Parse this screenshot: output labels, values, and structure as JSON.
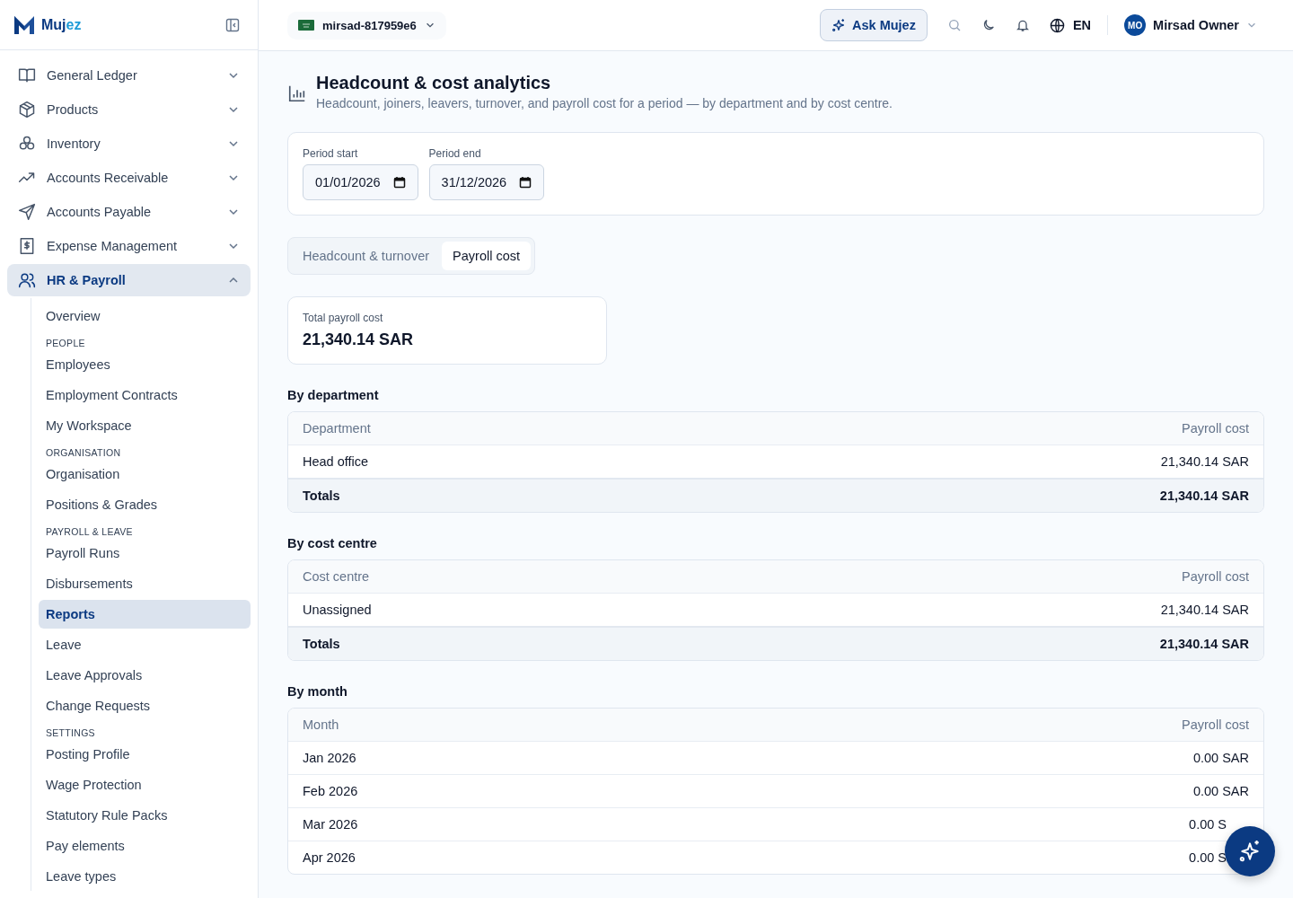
{
  "logo_text": [
    "Muj",
    "ez"
  ],
  "workspace": {
    "label": "mirsad-817959e6"
  },
  "header": {
    "ask_button": "Ask Mujez",
    "language": "EN",
    "user": {
      "initials": "MO",
      "name": "Mirsad Owner"
    }
  },
  "sidebar": {
    "items": [
      {
        "label": "General Ledger",
        "expanded": false,
        "selected": false
      },
      {
        "label": "Products",
        "expanded": false,
        "selected": false
      },
      {
        "label": "Inventory",
        "expanded": false,
        "selected": false
      },
      {
        "label": "Accounts Receivable",
        "expanded": false,
        "selected": false
      },
      {
        "label": "Accounts Payable",
        "expanded": false,
        "selected": false
      },
      {
        "label": "Expense Management",
        "expanded": false,
        "selected": false
      },
      {
        "label": "HR & Payroll",
        "expanded": true,
        "selected": true,
        "children": [
          {
            "kind": "link",
            "label": "Overview",
            "selected": false
          },
          {
            "kind": "heading",
            "label": "PEOPLE"
          },
          {
            "kind": "link",
            "label": "Employees",
            "selected": false
          },
          {
            "kind": "link",
            "label": "Employment Contracts",
            "selected": false
          },
          {
            "kind": "link",
            "label": "My Workspace",
            "selected": false
          },
          {
            "kind": "heading",
            "label": "ORGANISATION"
          },
          {
            "kind": "link",
            "label": "Organisation",
            "selected": false
          },
          {
            "kind": "link",
            "label": "Positions & Grades",
            "selected": false
          },
          {
            "kind": "heading",
            "label": "PAYROLL & LEAVE"
          },
          {
            "kind": "link",
            "label": "Payroll Runs",
            "selected": false
          },
          {
            "kind": "link",
            "label": "Disbursements",
            "selected": false
          },
          {
            "kind": "link",
            "label": "Reports",
            "selected": true
          },
          {
            "kind": "link",
            "label": "Leave",
            "selected": false
          },
          {
            "kind": "link",
            "label": "Leave Approvals",
            "selected": false
          },
          {
            "kind": "link",
            "label": "Change Requests",
            "selected": false
          },
          {
            "kind": "heading",
            "label": "SETTINGS"
          },
          {
            "kind": "link",
            "label": "Posting Profile",
            "selected": false
          },
          {
            "kind": "link",
            "label": "Wage Protection",
            "selected": false
          },
          {
            "kind": "link",
            "label": "Statutory Rule Packs",
            "selected": false
          },
          {
            "kind": "link",
            "label": "Pay elements",
            "selected": false
          },
          {
            "kind": "link",
            "label": "Leave types",
            "selected": false
          }
        ]
      }
    ]
  },
  "page": {
    "title": "Headcount & cost analytics",
    "subtitle": "Headcount, joiners, leavers, turnover, and payroll cost for a period — by department and by cost centre."
  },
  "filters": [
    {
      "label": "Period start",
      "value": "01/01/2026"
    },
    {
      "label": "Period end",
      "value": "31/12/2026"
    }
  ],
  "tabs": [
    {
      "label": "Headcount & turnover",
      "selected": false
    },
    {
      "label": "Payroll cost",
      "selected": true
    }
  ],
  "summary": {
    "label": "Total payroll cost",
    "value": "21,340.14 SAR"
  },
  "sections": [
    {
      "title": "By department",
      "columns": [
        "Department",
        "Payroll cost"
      ],
      "rows": [
        [
          "Head office",
          "21,340.14 SAR"
        ]
      ],
      "totals": [
        "Totals",
        "21,340.14 SAR"
      ]
    },
    {
      "title": "By cost centre",
      "columns": [
        "Cost centre",
        "Payroll cost"
      ],
      "rows": [
        [
          "Unassigned",
          "21,340.14 SAR"
        ]
      ],
      "totals": [
        "Totals",
        "21,340.14 SAR"
      ]
    },
    {
      "title": "By month",
      "columns": [
        "Month",
        "Payroll cost"
      ],
      "rows": [
        [
          "Jan 2026",
          "0.00 SAR"
        ],
        [
          "Feb 2026",
          "0.00 SAR"
        ],
        [
          "Mar 2026",
          "0.00 S"
        ],
        [
          "Apr 2026",
          "0.00 S"
        ]
      ]
    }
  ]
}
